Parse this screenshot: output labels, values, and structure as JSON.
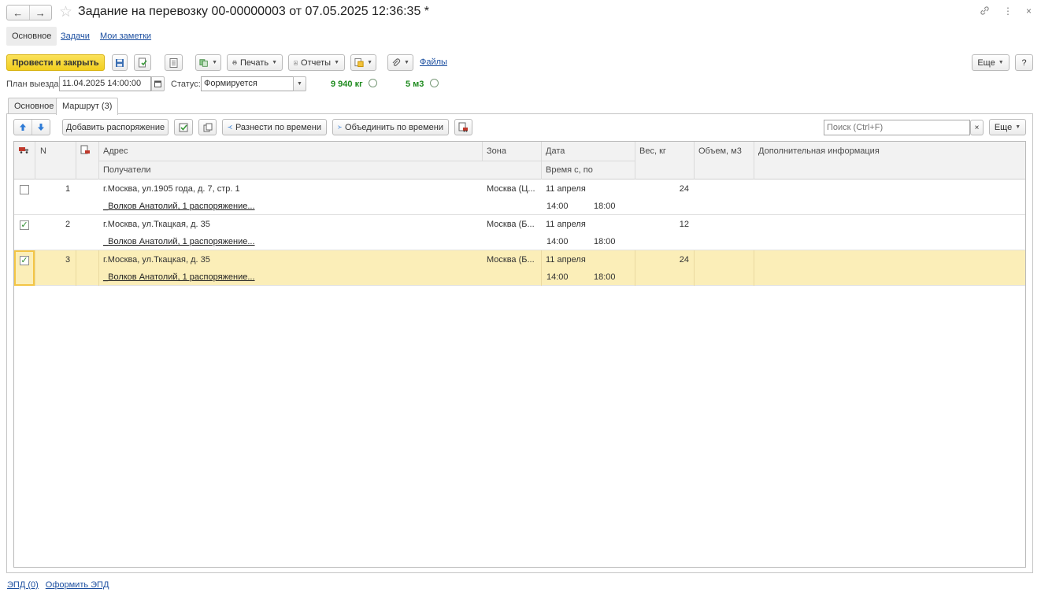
{
  "header": {
    "back": "←",
    "forward": "→",
    "star": "☆",
    "title": "Задание на перевозку 00-00000003 от 07.05.2025 12:36:35 *",
    "link_icon": "link-icon",
    "more_icon": "⋮",
    "close_icon": "×"
  },
  "sections": {
    "main": "Основное",
    "tasks": "Задачи",
    "notes": "Мои заметки"
  },
  "toolbar": {
    "post_close": "Провести и закрыть",
    "print": "Печать",
    "reports": "Отчеты",
    "files": "Файлы",
    "more": "Еще",
    "help": "?"
  },
  "plan": {
    "label": "План выезда:",
    "date": "11.04.2025 14:00:00",
    "status_label": "Статус:",
    "status_value": "Формируется",
    "weight": "9 940 кг",
    "volume": "5 м3"
  },
  "tabs": {
    "main": "Основное",
    "route": "Маршрут (3)"
  },
  "route_toolbar": {
    "add_order": "Добавить распоряжение",
    "split_time": "Разнести по времени",
    "merge_time": "Объединить по времени",
    "search_placeholder": "Поиск (Ctrl+F)",
    "clear": "×",
    "more": "Еще"
  },
  "grid": {
    "headers": {
      "n": "N",
      "address": "Адрес",
      "recipients": "Получатели",
      "zone": "Зона",
      "date": "Дата",
      "time": "Время с, по",
      "weight": "Вес, кг",
      "volume": "Объем, м3",
      "info": "Дополнительная информация"
    },
    "rows": [
      {
        "checked": "",
        "n": "1",
        "address": "г.Москва, ул.1905 года, д. 7, стр. 1",
        "recipient": "_Волков Анатолий, 1 распоряжение...",
        "zone": "Москва (Ц...",
        "date": "11 апреля",
        "time_from": "14:00",
        "time_to": "18:00",
        "weight": "24"
      },
      {
        "checked": "✓",
        "n": "2",
        "address": "г.Москва, ул.Ткацкая, д. 35",
        "recipient": "_Волков Анатолий, 1 распоряжение...",
        "zone": "Москва (Б...",
        "date": "11 апреля",
        "time_from": "14:00",
        "time_to": "18:00",
        "weight": "12"
      },
      {
        "checked": "✓",
        "n": "3",
        "address": "г.Москва, ул.Ткацкая, д. 35",
        "recipient": "_Волков Анатолий, 1 распоряжение...",
        "zone": "Москва (Б...",
        "date": "11 апреля",
        "time_from": "14:00",
        "time_to": "18:00",
        "weight": "24"
      }
    ]
  },
  "footer": {
    "epd": "ЭПД (0)",
    "make_epd": "Оформить ЭПД"
  },
  "colors": {
    "primary_button": "#f5d52e",
    "link": "#1c4fa0",
    "selected_row": "#fbeeb8",
    "green_value": "#1f8b1f"
  }
}
